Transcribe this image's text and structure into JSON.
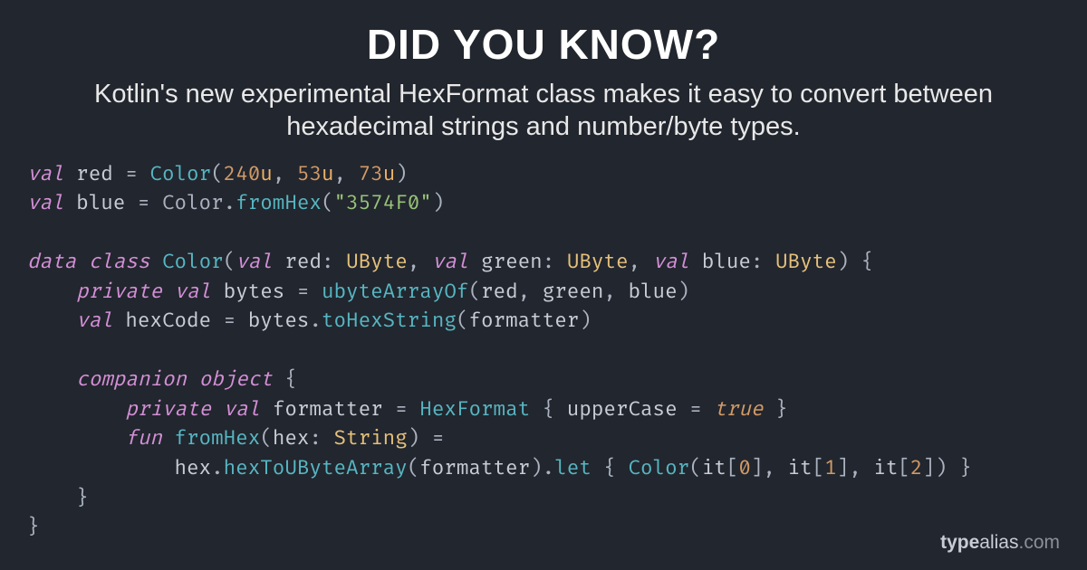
{
  "heading": "Did You Know?",
  "subtitle": "Kotlin's new experimental HexFormat class makes it easy to convert between hexadecimal strings and number/byte types.",
  "branding": {
    "bold": "type",
    "mid": "alias",
    "light": ".com"
  },
  "code": {
    "l1": {
      "kw_val": "val",
      "name": "red",
      "eq": " = ",
      "fn": "Color",
      "lp": "(",
      "n1": "240",
      "u": "u",
      "c1": ", ",
      "n2": "53",
      "c2": ", ",
      "n3": "73",
      "rp": ")"
    },
    "l2": {
      "kw_val": "val",
      "name": "blue",
      "eq": " = Color.",
      "fn": "fromHex",
      "lp": "(",
      "str": "\"3574F0\"",
      "rp": ")"
    },
    "l4": {
      "kw_data": "data",
      "sp": " ",
      "kw_class": "class",
      "call": "Color",
      "lp": "(",
      "kw_val1": "val",
      "p1": "red",
      "t1": "UByte",
      "kw_val2": "val",
      "p2": "green",
      "t2": "UByte",
      "kw_val3": "val",
      "p3": "blue",
      "t3": "UByte",
      "rp": ") {"
    },
    "l5": {
      "priv": "private",
      "kw_val": "val",
      "name": "bytes",
      "fn": "ubyteArrayOf",
      "a1": "red",
      "a2": "green",
      "a3": "blue"
    },
    "l6": {
      "kw_val": "val",
      "name": "hexCode",
      "recv": "bytes",
      "fn": "toHexString",
      "arg": "formatter"
    },
    "l8": {
      "kw_comp": "companion",
      "kw_obj": "object"
    },
    "l9": {
      "priv": "private",
      "kw_val": "val",
      "name": "formatter",
      "fn": "HexFormat",
      "prop": "upperCase",
      "val": "true"
    },
    "l10": {
      "kw_fun": "fun",
      "fn": "fromHex",
      "param": "hex",
      "ty": "String"
    },
    "l11": {
      "recv": "hex",
      "fn1": "hexToUByteArray",
      "arg1": "formatter",
      "fn2": "let",
      "fn3": "Color",
      "it": "it",
      "i0": "0",
      "i1": "1",
      "i2": "2"
    },
    "l12": {
      "close1": "}",
      "close2": "}"
    }
  }
}
